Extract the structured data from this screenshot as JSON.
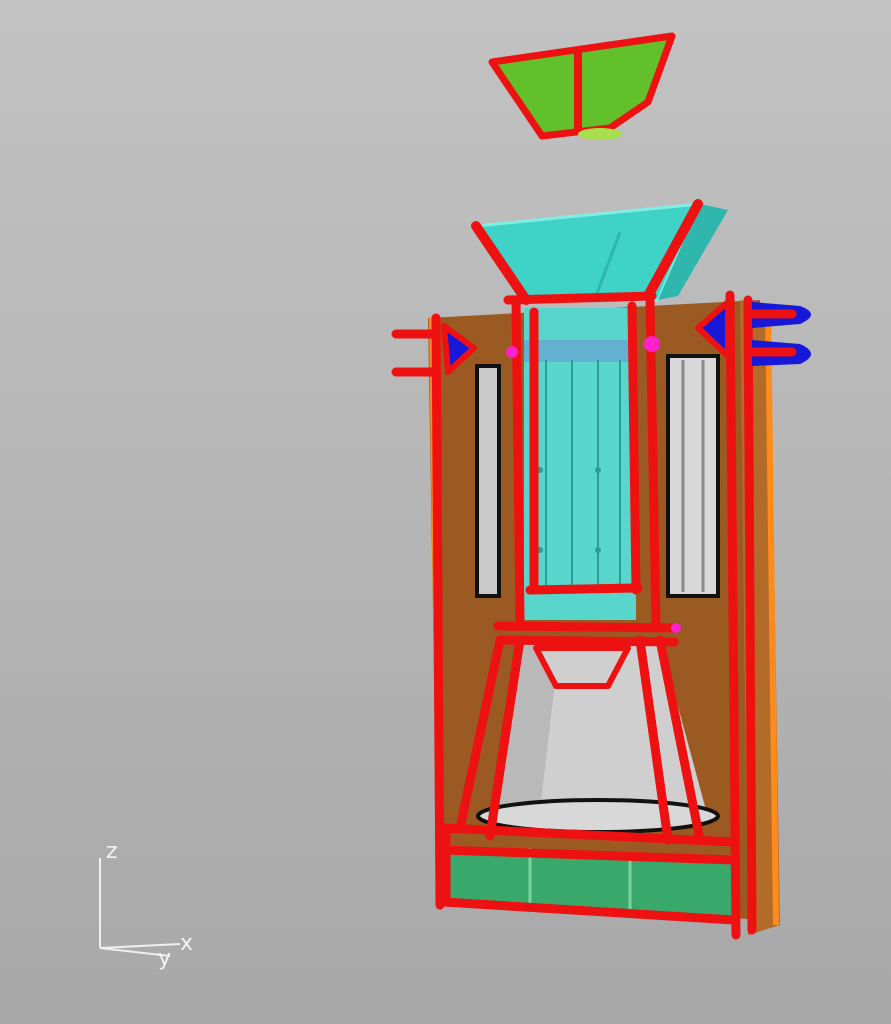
{
  "viewport": {
    "view": "perspective",
    "background": "#b9b9b9"
  },
  "colors": {
    "edge": "#ee1111",
    "hopper": "#3fd3c8",
    "chamber": "#58d6cc",
    "housing": "#9a5a22",
    "housing_edge": "#ff8c1a",
    "lid": "#62c02b",
    "base": "#3aa86b",
    "steel": "#cfcfcf",
    "connector": "#1818d8",
    "highlight": "#ff22cc"
  },
  "axis_widget": {
    "z": "z",
    "y": "y",
    "x": "x"
  }
}
